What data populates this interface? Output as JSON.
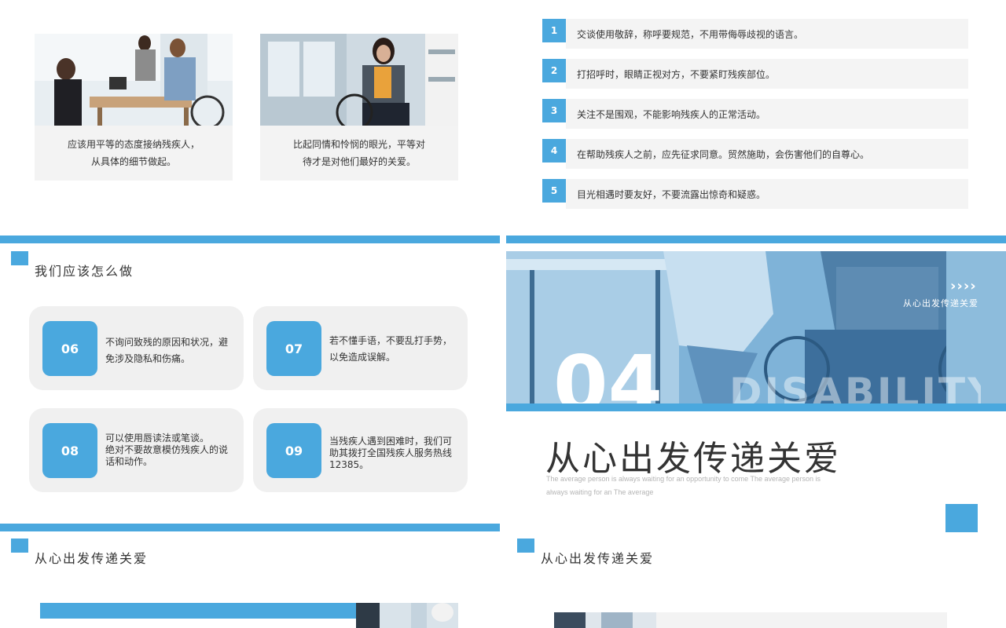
{
  "top_left": {
    "photo1_alt": "office-meeting-photo",
    "photo2_alt": "woman-in-wheelchair-photo",
    "caption1_line1": "应该用平等的态度接纳残疾人，",
    "caption1_line2": "从具体的细节做起。",
    "caption2_line1": "比起同情和怜悯的眼光，平等对",
    "caption2_line2": "待才是对他们最好的关爱。"
  },
  "top_right": {
    "items": [
      {
        "num": "1",
        "text": "交谈使用敬辞，称呼要规范，不用带侮辱歧视的语言。"
      },
      {
        "num": "2",
        "text": "打招呼时，眼睛正视对方，不要紧盯残疾部位。"
      },
      {
        "num": "3",
        "text": "关注不是围观，不能影响残疾人的正常活动。"
      },
      {
        "num": "4",
        "text": "在帮助残疾人之前，应先征求同意。贸然施助，会伤害他们的自尊心。"
      },
      {
        "num": "5",
        "text": "目光相遇时要友好，不要流露出惊奇和疑惑。"
      }
    ]
  },
  "mid_left": {
    "title": "我们应该怎么做",
    "cards": [
      {
        "num": "06",
        "line1": "不询问致残的原因和状况，避",
        "line2": "免涉及隐私和伤痛。"
      },
      {
        "num": "07",
        "line1": "若不懂手语，不要乱打手势，",
        "line2": "以免造成误解。"
      },
      {
        "num": "08",
        "line1": "可以使用唇读法或笔谈。",
        "line2": "绝对不要故意模仿残疾人的说",
        "line3": "话和动作。"
      },
      {
        "num": "09",
        "line1": "当残疾人遇到困难时，我们可",
        "line2": "助其拨打全国残疾人服务热线",
        "line3": "12385。"
      }
    ]
  },
  "mid_right": {
    "arrows": "››››",
    "small_label": "从心出发传递关爱",
    "big_number": "04",
    "bg_word": "DISABILITY",
    "title": "从心出发传递关爱",
    "subtitle_line1": "The average person is always waiting for an opportunity to come The average person is",
    "subtitle_line2": "always waiting for an The average"
  },
  "bottom_left": {
    "title": "从心出发传递关爱"
  },
  "bottom_right": {
    "title": "从心出发传递关爱"
  },
  "colors": {
    "accent": "#4aa8de",
    "card_bg": "#f0f0f0",
    "text": "#333333"
  }
}
